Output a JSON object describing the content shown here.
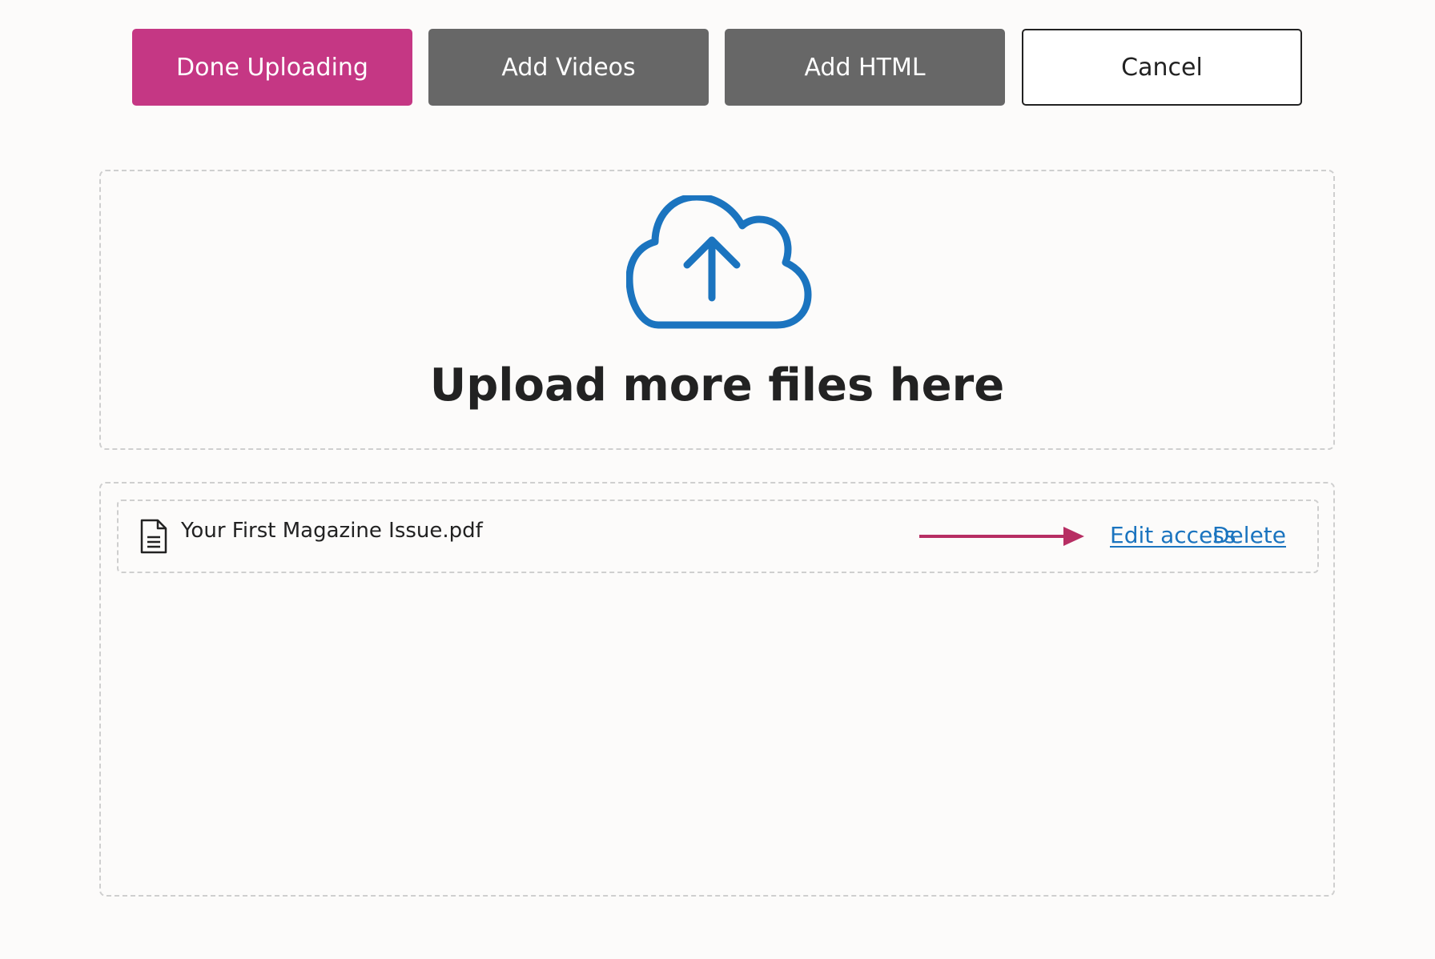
{
  "toolbar": {
    "done_label": "Done Uploading",
    "add_videos_label": "Add Videos",
    "add_html_label": "Add HTML",
    "cancel_label": "Cancel"
  },
  "dropzone": {
    "title": "Upload more files here",
    "icon": "cloud-upload-icon"
  },
  "files": [
    {
      "name": "Your First Magazine Issue.pdf",
      "icon": "document-icon",
      "actions": {
        "edit_access_label": "Edit access",
        "delete_label": "Delete"
      }
    }
  ],
  "colors": {
    "primary": "#c53784",
    "dark_button": "#676767",
    "link": "#1b74bf",
    "cloud_icon": "#1b74bf",
    "arrow": "#b72e63"
  }
}
